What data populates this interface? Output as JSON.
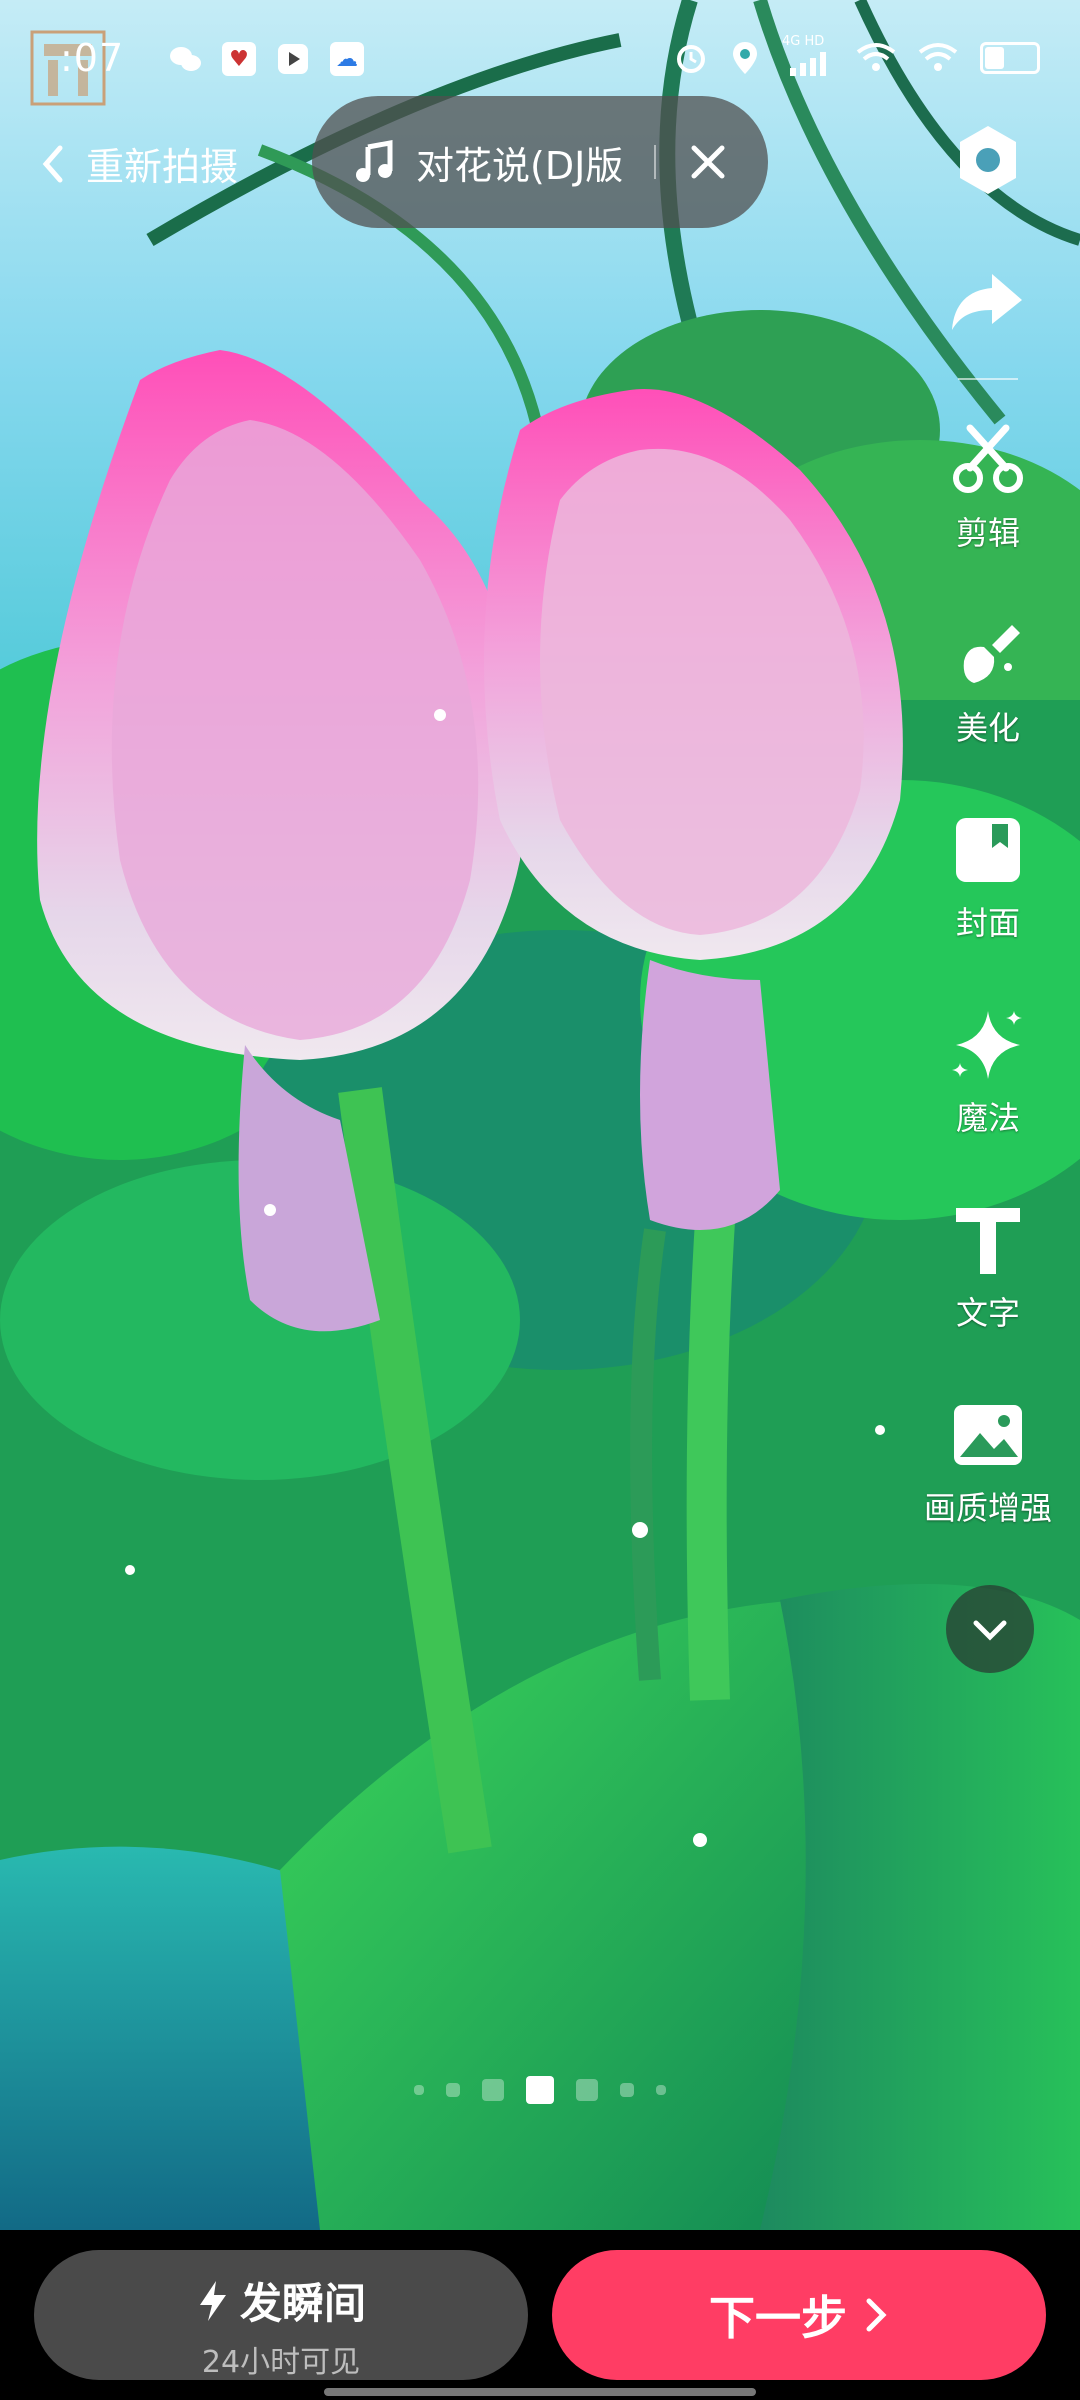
{
  "status_bar": {
    "time": ":07",
    "network": "4G HD"
  },
  "top_bar": {
    "back_label": "重新拍摄",
    "music_title": "对花说(DJ版",
    "music_close_icon": "close-icon"
  },
  "right_tools": [
    {
      "label": "",
      "icon": "settings-icon"
    },
    {
      "label": "",
      "icon": "share-icon"
    },
    {
      "label": "剪辑",
      "icon": "scissors-icon"
    },
    {
      "label": "美化",
      "icon": "beauty-icon"
    },
    {
      "label": "封面",
      "icon": "cover-icon"
    },
    {
      "label": "魔法",
      "icon": "magic-icon"
    },
    {
      "label": "文字",
      "icon": "text-icon"
    },
    {
      "label": "画质增强",
      "icon": "image-enhance-icon"
    }
  ],
  "pager": {
    "count": 7,
    "active_index": 3
  },
  "bottom": {
    "moment_label": "发瞬间",
    "moment_sub": "24小时可见",
    "next_label": "下一步"
  }
}
